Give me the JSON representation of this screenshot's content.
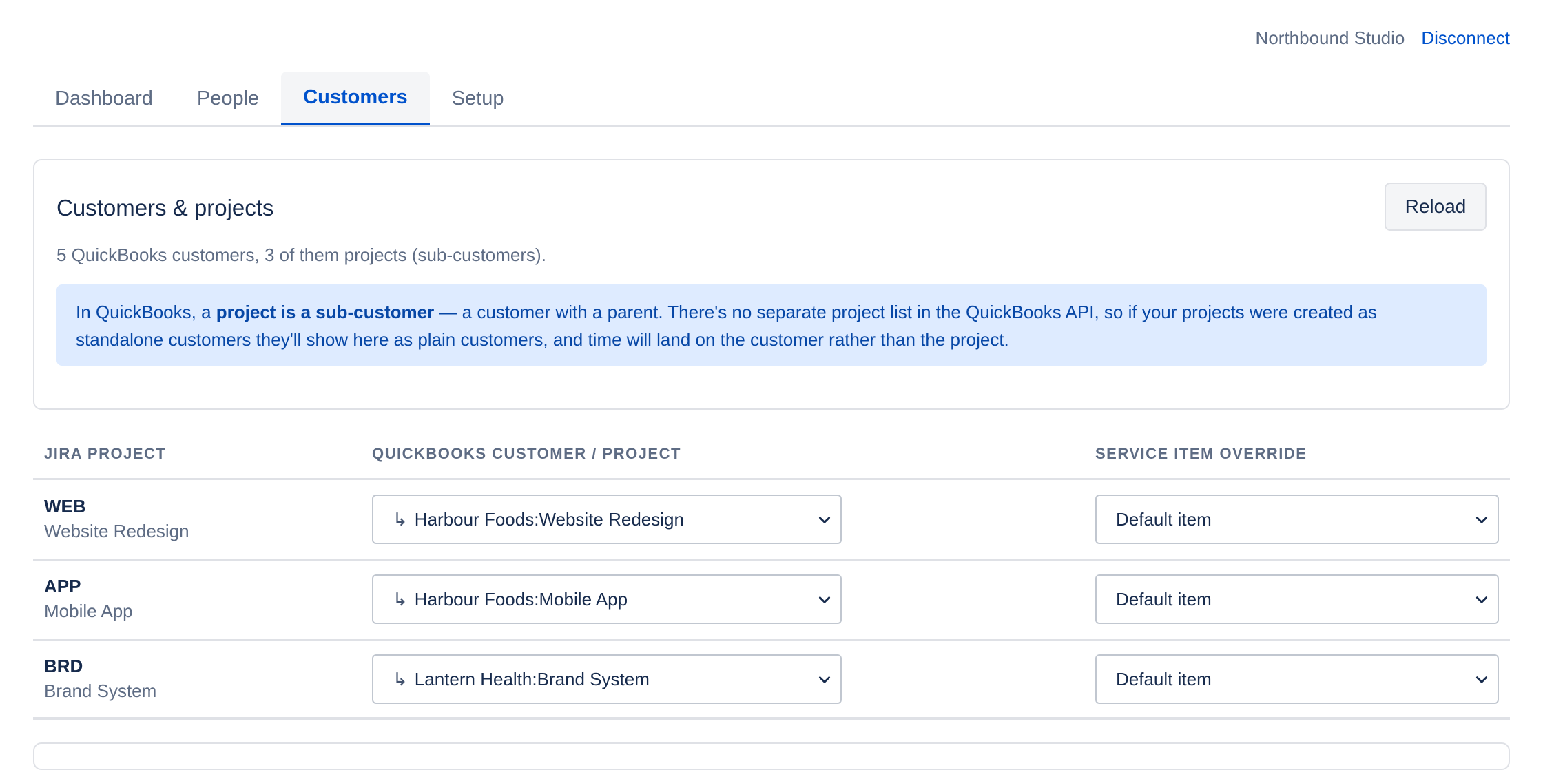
{
  "header": {
    "org_name": "Northbound Studio",
    "disconnect_label": "Disconnect"
  },
  "tabs": [
    {
      "label": "Dashboard",
      "active": false
    },
    {
      "label": "People",
      "active": false
    },
    {
      "label": "Customers",
      "active": true
    },
    {
      "label": "Setup",
      "active": false
    }
  ],
  "card": {
    "title": "Customers & projects",
    "reload_label": "Reload",
    "summary": "5 QuickBooks customers, 3 of them projects (sub-customers).",
    "info": {
      "prefix": "In QuickBooks, a ",
      "bold": "project is a sub-customer",
      "suffix": " — a customer with a parent. There's no separate project list in the QuickBooks API, so if your projects were created as standalone customers they'll show here as plain customers, and time will land on the customer rather than the project."
    }
  },
  "table": {
    "headers": {
      "jira_project": "JIRA PROJECT",
      "qb_customer": "QUICKBOOKS CUSTOMER / PROJECT",
      "service_item": "SERVICE ITEM OVERRIDE"
    },
    "sub_marker": "↳",
    "rows": [
      {
        "key": "WEB",
        "name": "Website Redesign",
        "customer": "Harbour Foods:Website Redesign",
        "service_item": "Default item"
      },
      {
        "key": "APP",
        "name": "Mobile App",
        "customer": "Harbour Foods:Mobile App",
        "service_item": "Default item"
      },
      {
        "key": "BRD",
        "name": "Brand System",
        "customer": "Lantern Health:Brand System",
        "service_item": "Default item"
      }
    ]
  },
  "colors": {
    "accent": "#0052cc",
    "info_bg": "#deebff",
    "info_text": "#0747a6",
    "muted_text": "#5e6c84",
    "border": "#dfe1e6"
  }
}
